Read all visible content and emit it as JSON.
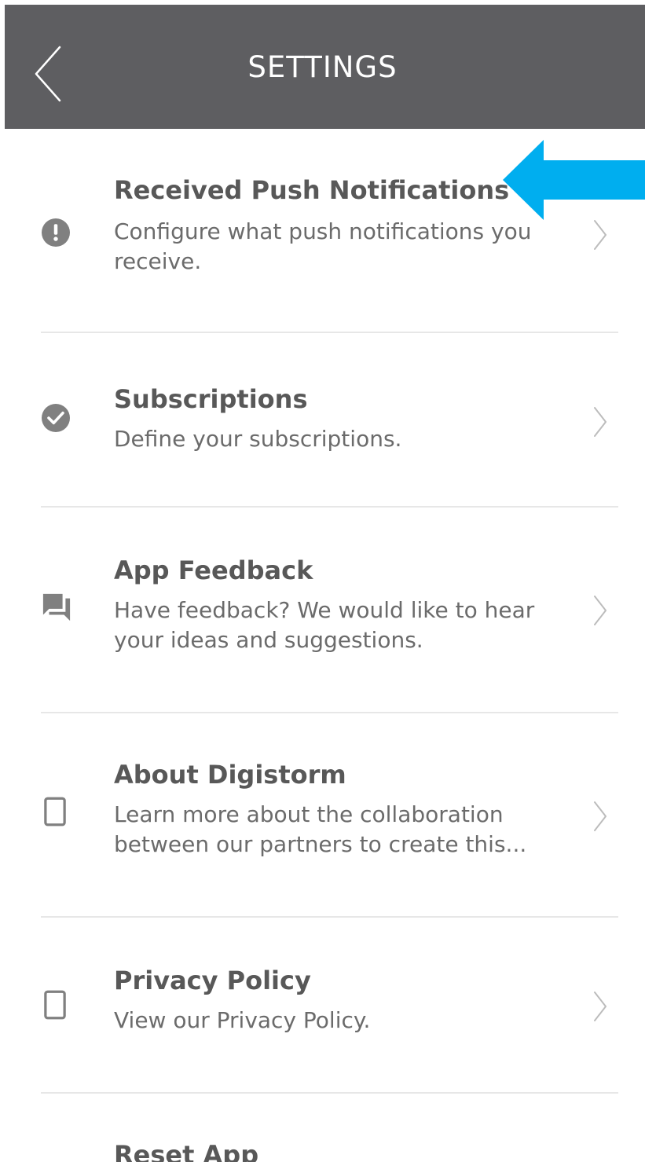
{
  "header": {
    "title": "SETTINGS",
    "background_color": "#5e5e61"
  },
  "items": [
    {
      "title": "Received Push Notifications",
      "description": "Configure what push notifications you receive.",
      "icon": "alert-circle-icon"
    },
    {
      "title": "Subscriptions",
      "description": "Define your subscriptions.",
      "icon": "check-circle-icon"
    },
    {
      "title": "App Feedback",
      "description": "Have feedback? We would like to hear your ideas and suggestions.",
      "icon": "chat-bubbles-icon"
    },
    {
      "title": "About Digistorm",
      "description": "Learn more about the collaboration between our partners to create this...",
      "icon": "phone-device-icon"
    },
    {
      "title": "Privacy Policy",
      "description": "View our Privacy Policy.",
      "icon": "phone-device-icon"
    },
    {
      "title": "Reset App",
      "description": "",
      "icon": ""
    }
  ],
  "annotation": {
    "icon": "pointer-arrow-icon",
    "color": "#00aeef"
  },
  "colors": {
    "title_text": "#585858",
    "description_text": "#6b6b6b",
    "icon": "#808080",
    "chevron": "#bcbcbc",
    "divider": "#e7e7e7"
  }
}
